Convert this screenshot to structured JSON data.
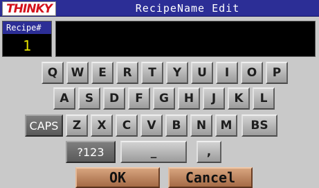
{
  "header": {
    "logo_text": "THINKY",
    "title": "RecipeName Edit"
  },
  "recipe": {
    "label": "Recipe#",
    "number": "1"
  },
  "name_field": {
    "value": ""
  },
  "keyboard": {
    "row1": [
      "Q",
      "W",
      "E",
      "R",
      "T",
      "Y",
      "U",
      "I",
      "O",
      "P"
    ],
    "row2": [
      "A",
      "S",
      "D",
      "F",
      "G",
      "H",
      "J",
      "K",
      "L"
    ],
    "row3": [
      "Z",
      "X",
      "C",
      "V",
      "B",
      "N",
      "M"
    ],
    "caps": "CAPS",
    "backspace": "BS",
    "symbols": "?123",
    "underscore": "_",
    "comma": ","
  },
  "actions": {
    "ok": "OK",
    "cancel": "Cancel"
  }
}
